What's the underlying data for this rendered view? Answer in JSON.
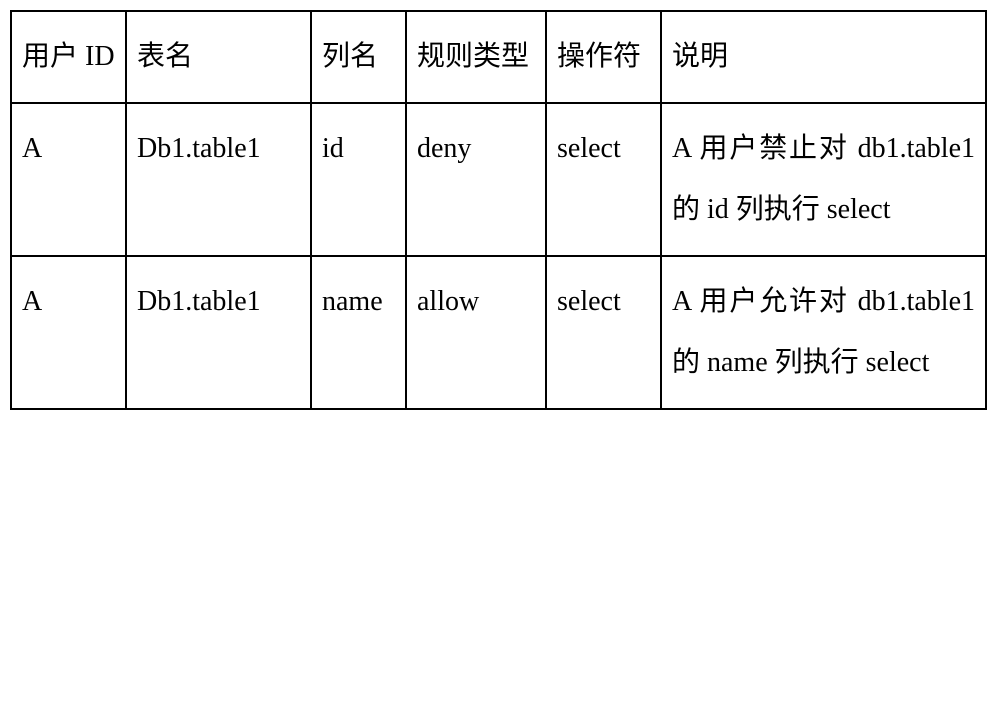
{
  "table": {
    "headers": {
      "user_id": "用户 ID",
      "table_name": "表名",
      "column_name": "列名",
      "rule_type": "规则类型",
      "operator": "操作符",
      "description": "说明"
    },
    "rows": [
      {
        "user_id": "A",
        "table_name": "Db1.table1",
        "column_name": "id",
        "rule_type": "deny",
        "operator": "select",
        "description": "A 用户禁止对 db1.table1 的 id 列执行 select"
      },
      {
        "user_id": "A",
        "table_name": "Db1.table1",
        "column_name": "name",
        "rule_type": "allow",
        "operator": "select",
        "description": "A 用户允许对 db1.table1 的 name 列执行 select"
      }
    ]
  }
}
